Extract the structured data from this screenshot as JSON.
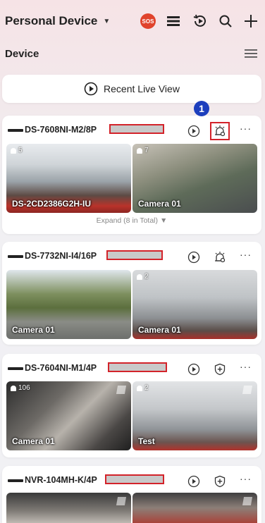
{
  "header": {
    "title": "Personal Device",
    "caret": "▼",
    "sos_label": "SOS",
    "section_label": "Device"
  },
  "recent_live_view": {
    "label": "Recent Live View"
  },
  "devices": [
    {
      "name": "DS-7608NI-M2/8P",
      "cameras": [
        {
          "label": "DS-2CD2386G2H-IU",
          "count": "5"
        },
        {
          "label": "Camera 01",
          "count": "7"
        }
      ],
      "expand_label": "Expand (8 in Total)",
      "expand_caret": "▼",
      "annotation_badge": "1"
    },
    {
      "name": "DS-7732NI-I4/16P",
      "cameras": [
        {
          "label": "Camera 01",
          "count": ""
        },
        {
          "label": "Camera 01",
          "count": "2"
        }
      ]
    },
    {
      "name": "DS-7604NI-M1/4P",
      "cameras": [
        {
          "label": "Camera 01",
          "count": "106"
        },
        {
          "label": "Test",
          "count": "2"
        }
      ]
    },
    {
      "name": "NVR-104MH-K/4P",
      "cameras": [
        {
          "label": "",
          "count": ""
        },
        {
          "label": "",
          "count": ""
        }
      ]
    }
  ],
  "more_label": "···",
  "colors": {
    "accent_red": "#d3232a",
    "badge_blue": "#1d3fbd",
    "sos_red": "#e0432c"
  }
}
